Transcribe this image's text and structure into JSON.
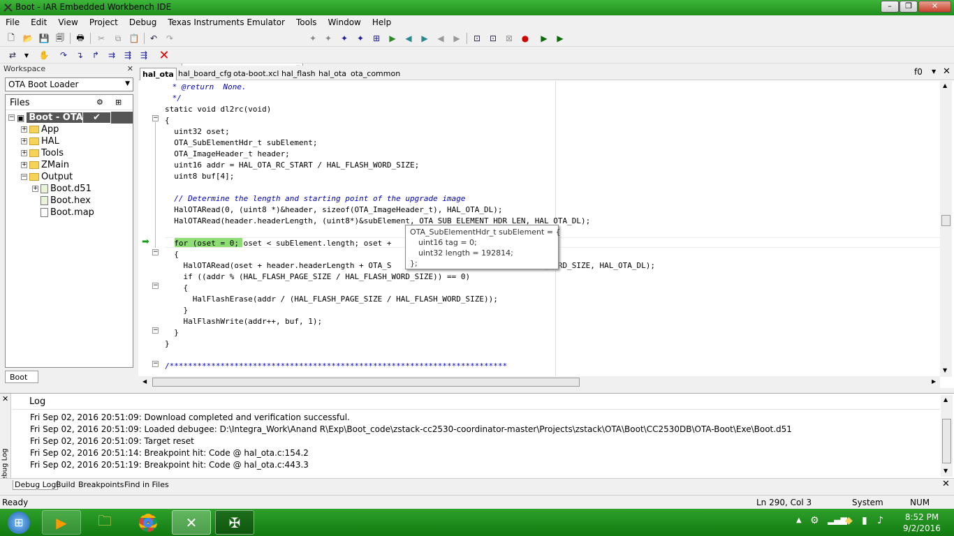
{
  "window": {
    "title": "Boot - IAR Embedded Workbench IDE"
  },
  "menu": [
    "File",
    "Edit",
    "View",
    "Project",
    "Debug",
    "Texas Instruments Emulator",
    "Tools",
    "Window",
    "Help"
  ],
  "workspace": {
    "header": "Workspace",
    "config": "OTA Boot Loader",
    "files_label": "Files",
    "tree": [
      {
        "label": "Boot - OTA...",
        "check": "✔"
      },
      {
        "label": "App"
      },
      {
        "label": "HAL"
      },
      {
        "label": "Tools"
      },
      {
        "label": "ZMain"
      },
      {
        "label": "Output"
      },
      {
        "label": "Boot.d51"
      },
      {
        "label": "Boot.hex"
      },
      {
        "label": "Boot.map"
      }
    ],
    "tab": "Boot"
  },
  "editor": {
    "tabs": [
      "hal_ota",
      "hal_board_cfg",
      "ota-boot.xcl",
      "hal_flash",
      "hal_ota",
      "ota_common"
    ],
    "func_nav": "f0",
    "lines": [
      " * @return  None.",
      " */",
      "static void dl2rc(void)",
      "{",
      "  uint32 oset;",
      "  OTA_SubElementHdr_t subElement;",
      "  OTA_ImageHeader_t header;",
      "  uint16 addr = HAL_OTA_RC_START / HAL_FLASH_WORD_SIZE;",
      "  uint8 buf[4];",
      "",
      "  // Determine the length and starting point of the upgrade image",
      "  HalOTARead(0, (uint8 *)&header, sizeof(OTA_ImageHeader_t), HAL_OTA_DL);",
      "  HalOTARead(header.headerLength, (uint8*)&subElement, OTA_SUB_ELEMENT_HDR_LEN, HAL_OTA_DL);",
      "",
      "  for (oset = 0; oset < subElement.length; oset +",
      "  {",
      "    HalOTARead(oset + header.headerLength + OTA_S                              ASH_WORD_SIZE, HAL_OTA_DL);",
      "    if ((addr % (HAL_FLASH_PAGE_SIZE / HAL_FLASH_WORD_SIZE)) == 0)",
      "    {",
      "      HalFlashErase(addr / (HAL_FLASH_PAGE_SIZE / HAL_FLASH_WORD_SIZE));",
      "    }",
      "    HalFlashWrite(addr++, buf, 1);",
      "  }",
      "}",
      "",
      "/*************************************************************************"
    ],
    "tooltip": [
      "OTA_SubElementHdr_t subElement = {",
      "  uint16 tag = 0;",
      "  uint32 length = 192814;",
      "};"
    ]
  },
  "log": {
    "header": "Log",
    "side_label": "Debug Log",
    "lines": [
      "Fri Sep 02, 2016 20:51:09: Download completed and verification successful.",
      "Fri Sep 02, 2016 20:51:09: Loaded debugee: D:\\Integra_Work\\Anand R\\Exp\\Boot_code\\zstack-cc2530-coordinator-master\\Projects\\zstack\\OTA\\Boot\\CC2530DB\\OTA-Boot\\Exe\\Boot.d51",
      "Fri Sep 02, 2016 20:51:09: Target reset",
      "Fri Sep 02, 2016 20:51:14: Breakpoint hit: Code @ hal_ota.c:154.2",
      "Fri Sep 02, 2016 20:51:19: Breakpoint hit: Code @ hal_ota.c:443.3"
    ],
    "tabs": [
      "Debug Log",
      "Build",
      "Breakpoints",
      "Find in Files"
    ]
  },
  "status": {
    "left": "Ready",
    "position": "Ln 290, Col 3",
    "system": "System",
    "num": "NUM"
  },
  "clock": {
    "time": "8:52 PM",
    "date": "9/2/2016"
  }
}
